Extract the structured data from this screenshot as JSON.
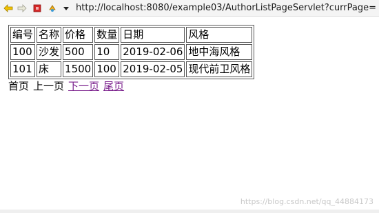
{
  "browser": {
    "url": "http://localhost:8080/example03/AuthorListPageServlet?currPage=",
    "icons": [
      "back-arrow-icon",
      "forward-arrow-icon",
      "stop-icon",
      "refresh-icon",
      "dropdown-icon"
    ]
  },
  "table": {
    "headers": [
      "编号",
      "名称",
      "价格",
      "数量",
      "日期",
      "风格"
    ],
    "rows": [
      [
        "100",
        "沙发",
        "500",
        "10",
        "2019-02-06",
        "地中海风格"
      ],
      [
        "101",
        "床",
        "1500",
        "100",
        "2019-02-05",
        "现代前卫风格"
      ]
    ]
  },
  "pager": {
    "first": "首页",
    "prev": "上一页",
    "next": "下一页",
    "last": "尾页"
  },
  "watermark": "https://blog.csdn.net/qq_44884173",
  "colors": {
    "link": "#7a1f8c",
    "border": "#555555"
  }
}
